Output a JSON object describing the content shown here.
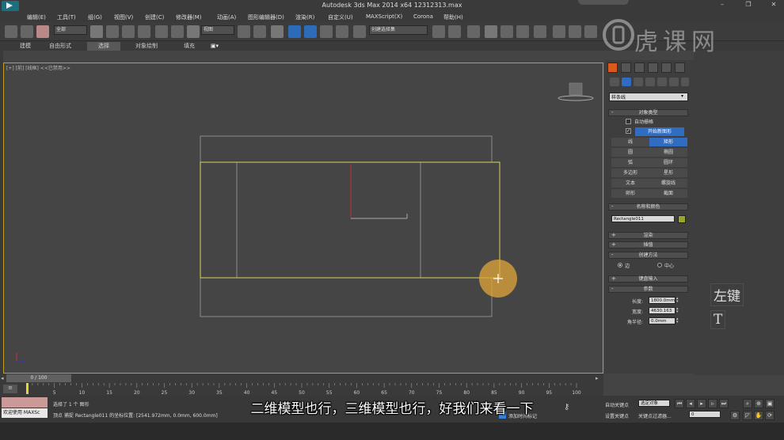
{
  "app": {
    "window_title": "Autodesk 3ds Max  2014 x64     12312313.max"
  },
  "menu": [
    "编辑(E)",
    "工具(T)",
    "组(G)",
    "视图(V)",
    "创建(C)",
    "修改器(M)",
    "动画(A)",
    "图形编辑器(D)",
    "渲染(R)",
    "自定义(U)",
    "MAXScript(X)",
    "Corona",
    "帮助(H)"
  ],
  "toolbar": {
    "selection_filter": "全部",
    "reference_coord": "视图",
    "named_selection": "创建选择集"
  },
  "ribbon_tabs": [
    "建模",
    "自由形式",
    "选择",
    "对象绘制",
    "填充"
  ],
  "viewport": {
    "label": "[+] [前] [线框]  <<已禁用>>"
  },
  "command_panel": {
    "category_dropdown": "样条线",
    "object_type_header": "对象类型",
    "auto_grid_label": "自动栅格",
    "start_new_shape_label": "开始新图形",
    "shape_buttons": [
      {
        "left": "线",
        "right": "矩形"
      },
      {
        "left": "圆",
        "right": "椭圆"
      },
      {
        "left": "弧",
        "right": "圆环"
      },
      {
        "left": "多边形",
        "right": "星形"
      },
      {
        "left": "文本",
        "right": "螺旋线"
      },
      {
        "left": "卵形",
        "right": "截面"
      }
    ],
    "name_color_header": "名称和颜色",
    "object_name": "Rectangle011",
    "object_color": "#9aa32a",
    "render_header": "渲染",
    "interpolation_header": "插值",
    "creation_method_header": "创建方法",
    "creation_edge_label": "边",
    "creation_center_label": "中心",
    "keyboard_input_header": "键盘输入",
    "params_header": "参数",
    "length_label": "长度:",
    "length_value": "1800.0mm",
    "width_label": "宽度:",
    "width_value": "4630.163",
    "corner_radius_label": "角半径:",
    "corner_radius_value": "0.0mm"
  },
  "overlay_keys": {
    "left_key": "左键",
    "t_key": "T"
  },
  "time_slider": {
    "value": "0 / 100"
  },
  "trackbar_ticks": [
    "0",
    "5",
    "10",
    "15",
    "20",
    "25",
    "30",
    "35",
    "40",
    "45",
    "50",
    "55",
    "60",
    "65",
    "70",
    "75",
    "80",
    "85",
    "90",
    "95",
    "100"
  ],
  "status": {
    "welcome": "欢迎使用 MAXSc",
    "selected_msg": "选择了 1 个 图形",
    "prompt_msg": "顶点 捕捉 Rectangle011 的坐标位置: [2541.972mm, 0.0mm, 600.0mm]",
    "add_time_tag": "添加时间标记"
  },
  "keybar": {
    "auto_key": "自动关键点",
    "selected_object": "选定对象",
    "set_key": "设置关键点",
    "key_filters": "关键点过滤器...",
    "frame_value": "0"
  },
  "subtitle": "二维模型也行，三维模型也行，好我们来看一下",
  "watermark": "虎课网"
}
